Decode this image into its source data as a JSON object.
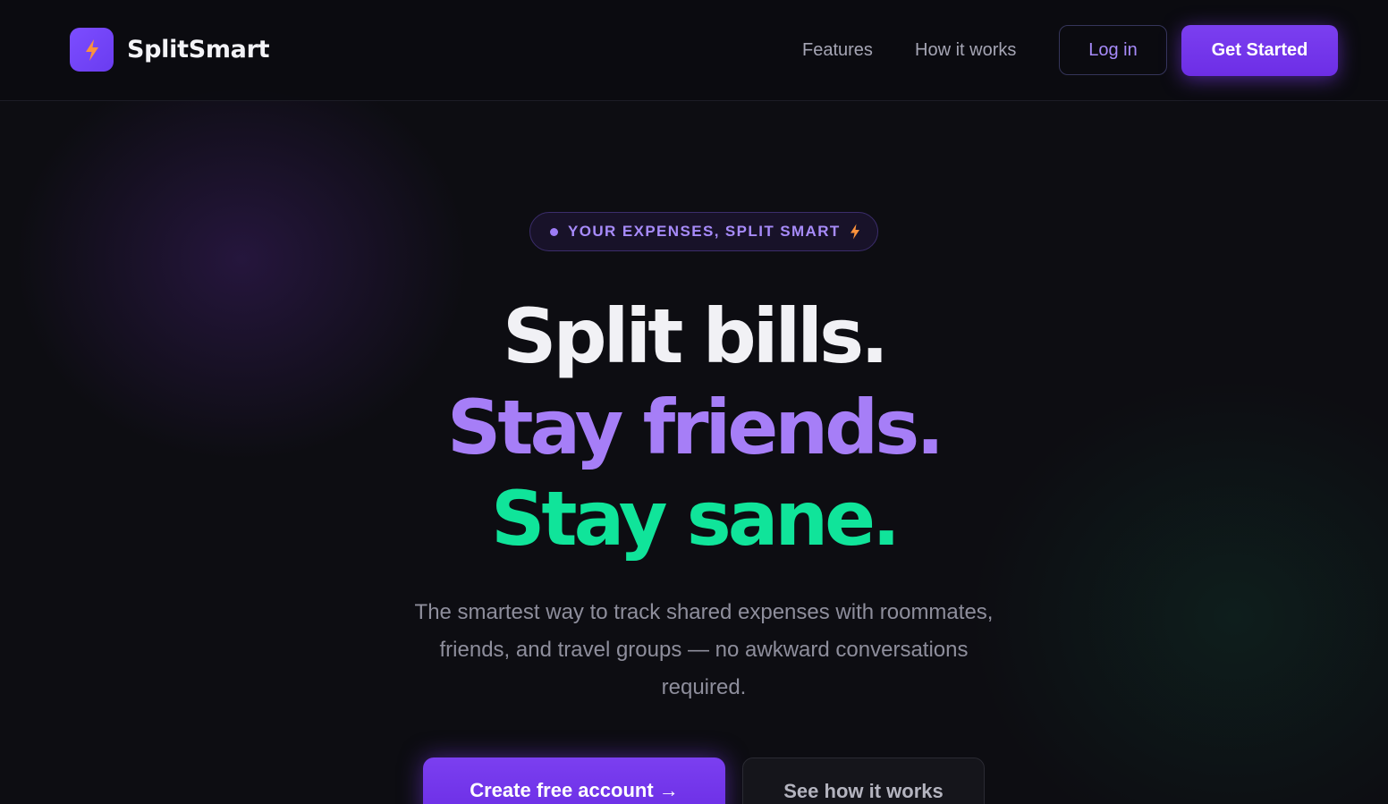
{
  "brand": {
    "name": "SplitSmart",
    "icon": "lightning-bolt-icon"
  },
  "nav": {
    "links": [
      "Features",
      "How it works"
    ],
    "login_label": "Log in",
    "cta_label": "Get Started"
  },
  "hero": {
    "badge_label": "YOUR EXPENSES, SPLIT SMART",
    "headline": [
      "Split bills.",
      "Stay friends.",
      "Stay sane."
    ],
    "subtitle": "The smartest way to track shared expenses with roommates, friends, and travel groups — no awkward conversations required.",
    "primary_cta": "Create free account →",
    "secondary_cta": "See how it works"
  },
  "colors": {
    "accent": "#7c3aed",
    "headline_purple": "#a67ef7",
    "headline_green": "#10e49a",
    "bolt_orange": "#fb923c"
  }
}
